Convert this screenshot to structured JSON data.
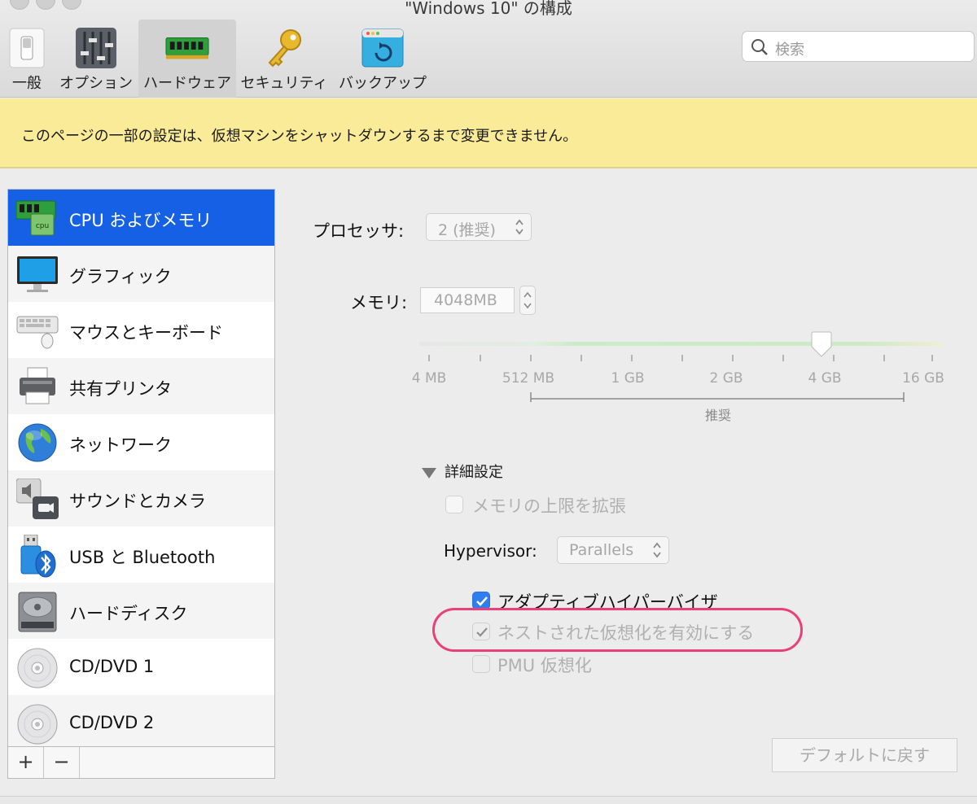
{
  "window": {
    "title": "\"Windows 10\" の構成"
  },
  "toolbar": {
    "items": [
      {
        "label": "一般",
        "icon": "switch-icon"
      },
      {
        "label": "オプション",
        "icon": "sliders-icon"
      },
      {
        "label": "ハードウェア",
        "icon": "ram-icon",
        "active": true
      },
      {
        "label": "セキュリティ",
        "icon": "key-icon"
      },
      {
        "label": "バックアップ",
        "icon": "backup-icon"
      }
    ]
  },
  "search": {
    "placeholder": "検索"
  },
  "banner": {
    "text": "このページの一部の設定は、仮想マシンをシャットダウンするまで変更できません。"
  },
  "sidebar": {
    "items": [
      {
        "label": "CPU およびメモリ",
        "icon": "cpu-memory-icon",
        "selected": true
      },
      {
        "label": "グラフィック",
        "icon": "monitor-icon"
      },
      {
        "label": "マウスとキーボード",
        "icon": "keyboard-icon"
      },
      {
        "label": "共有プリンタ",
        "icon": "printer-icon"
      },
      {
        "label": "ネットワーク",
        "icon": "globe-icon"
      },
      {
        "label": "サウンドとカメラ",
        "icon": "speaker-camera-icon"
      },
      {
        "label": "USB と Bluetooth",
        "icon": "usb-bluetooth-icon"
      },
      {
        "label": "ハードディスク",
        "icon": "harddisk-icon"
      },
      {
        "label": "CD/DVD 1",
        "icon": "disc-icon"
      },
      {
        "label": "CD/DVD 2",
        "icon": "disc-icon"
      }
    ],
    "footer": {
      "add": "+",
      "remove": "−"
    }
  },
  "main": {
    "processor": {
      "label": "プロセッサ:",
      "value": "2 (推奨)"
    },
    "memory": {
      "label": "メモリ:",
      "value": "4048MB",
      "ticks": [
        "4 MB",
        "512 MB",
        "1 GB",
        "2 GB",
        "4 GB",
        "16 GB"
      ],
      "recommended_label": "推奨",
      "slider_position": 0.78
    },
    "advanced": {
      "title": "詳細設定",
      "extend_memory": {
        "label": "メモリの上限を拡張",
        "checked": false
      },
      "hypervisor": {
        "label": "Hypervisor:",
        "value": "Parallels"
      },
      "adaptive": {
        "label": "アダプティブハイパーバイザ",
        "checked": true
      },
      "nested": {
        "label": "ネストされた仮想化を有効にする",
        "checked": true
      },
      "pmu": {
        "label": "PMU 仮想化",
        "checked": false
      }
    },
    "restore_button": "デフォルトに戻す"
  },
  "colors": {
    "selection": "#1560e4",
    "banner": "#faeb98",
    "highlight_ring": "#e9407a",
    "checkbox": "#2f7ef0"
  }
}
